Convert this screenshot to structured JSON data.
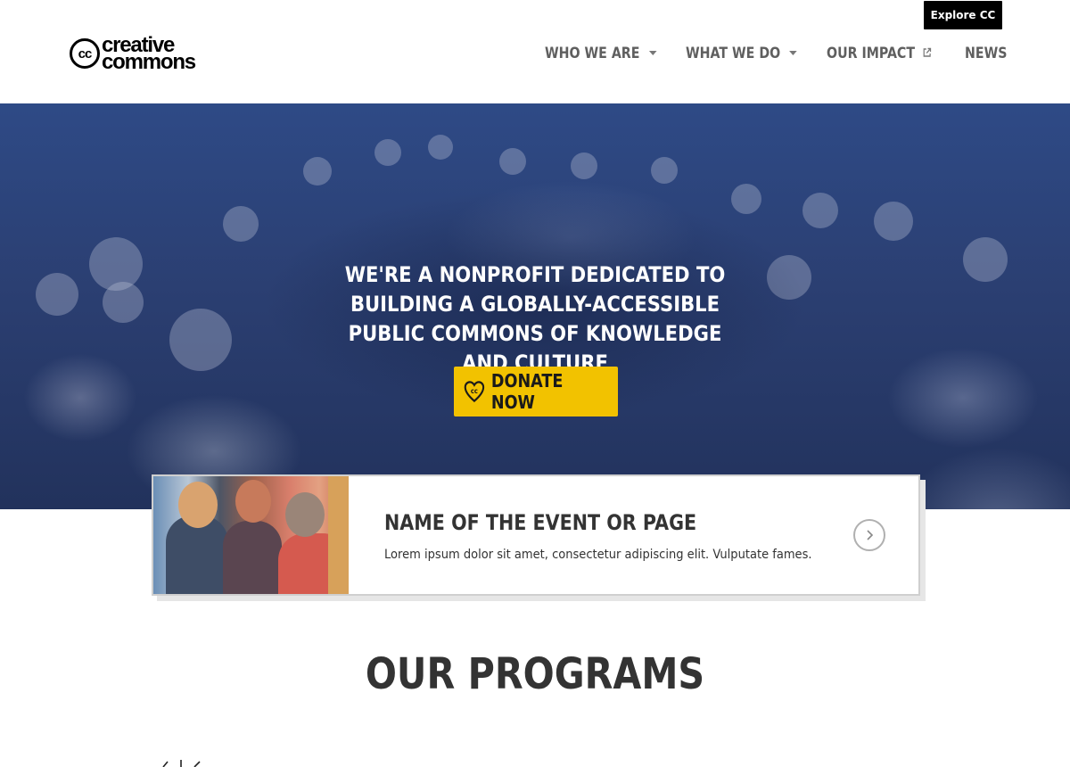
{
  "header": {
    "explore_label": "Explore CC",
    "logo": {
      "mark": "cc",
      "line1": "creative",
      "line2": "commons"
    },
    "nav": [
      {
        "label": "WHO WE ARE",
        "icon": "chevron-down-icon"
      },
      {
        "label": "WHAT WE DO",
        "icon": "chevron-down-icon"
      },
      {
        "label": "OUR IMPACT",
        "icon": "external-link-icon"
      },
      {
        "label": "NEWS"
      }
    ]
  },
  "hero": {
    "headline": "WE'RE A NONPROFIT DEDICATED TO BUILDING A GLOBALLY-ACCESSIBLE PUBLIC COMMONS OF KNOWLEDGE AND CULTURE",
    "donate_label": "DONATE NOW",
    "donate_icon": "cc-heart-icon"
  },
  "event_card": {
    "title": "NAME OF THE EVENT OR PAGE",
    "description": "Lorem ipsum dolor sit amet, consectetur adipiscing elit. Vulputate fames.",
    "arrow_icon": "chevron-right-icon"
  },
  "programs": {
    "title": "OUR PROGRAMS"
  },
  "colors": {
    "accent": "#f2c200",
    "hero_overlay": "#2b3f72",
    "text": "#333333",
    "nav_text": "#5f5f5f"
  }
}
